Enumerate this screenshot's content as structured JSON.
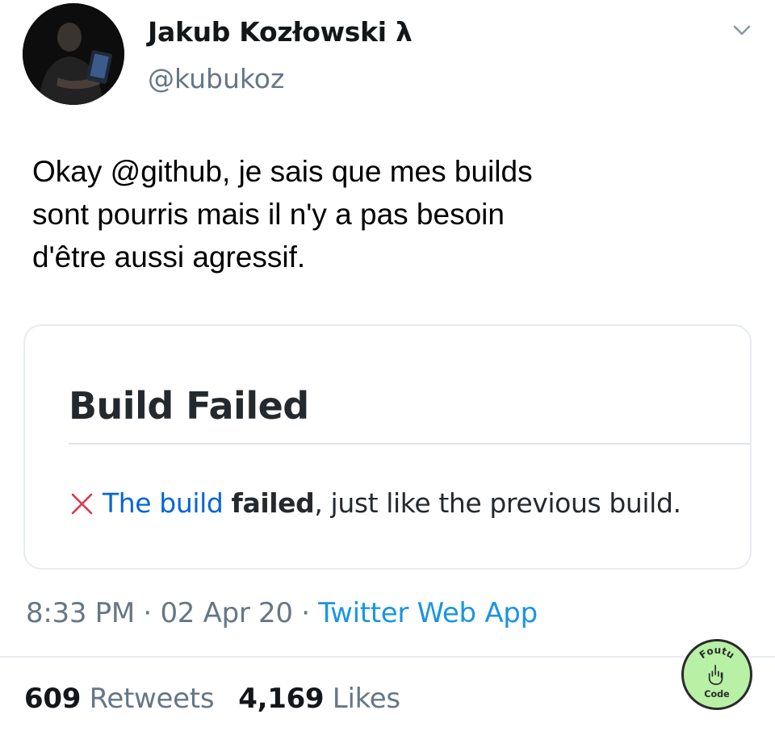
{
  "author": {
    "display_name": "Jakub Kozłowski λ",
    "handle": "@kubukoz",
    "avatar_icon": "profile-photo"
  },
  "tweet": {
    "text": "Okay @github, je sais que mes builds\nsont pourris mais il n'y a pas besoin\nd'être aussi agressif."
  },
  "card": {
    "title": "Build Failed",
    "line": {
      "icon": "x-icon",
      "part1": "The build",
      "part2": "failed",
      "part3": ", just like the previous build."
    }
  },
  "meta": {
    "time": "8:33 PM",
    "sep1": " · ",
    "date": "02 Apr 20",
    "sep2": " · ",
    "source": "Twitter Web App"
  },
  "stats": {
    "retweets_count": "609",
    "retweets_label": "Retweets",
    "likes_count": "4,169",
    "likes_label": "Likes"
  },
  "watermark": {
    "top_text": "Foutu",
    "bottom_text": "Code"
  },
  "colors": {
    "link": "#1b95e0",
    "secondary": "#657786",
    "github_blue": "#0366d6",
    "fail_red": "#d73a49"
  }
}
